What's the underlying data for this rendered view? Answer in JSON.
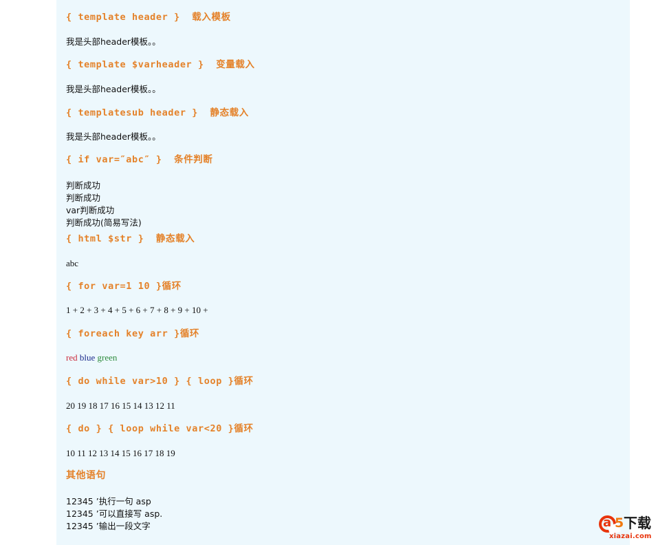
{
  "page": {
    "background_color": "#ffffff",
    "panel_color": "#edf8fd",
    "accent_color": "#e4822a",
    "text_color": "#111111"
  },
  "sections": [
    {
      "id": "template-header",
      "heading": "{ template header }  载入模板",
      "body": "我是头部header模板。。"
    },
    {
      "id": "template-varheader",
      "heading": "{ template $varheader }  变量载入",
      "body": "我是头部header模板。。"
    },
    {
      "id": "templatesub-header",
      "heading": "{ templatesub header }  静态载入",
      "body": "我是头部header模板。。"
    },
    {
      "id": "if-condition",
      "heading": "{ if var=″abc″ }  条件判断",
      "lines": [
        "判断成功",
        "判断成功",
        "var判断成功",
        "判断成功(简易写法)"
      ]
    },
    {
      "id": "html-str",
      "heading": "{ html $str }  静态载入",
      "body": "abc"
    },
    {
      "id": "for-loop",
      "heading": "{ for var=1 10 }循环",
      "body": "1 + 2 + 3 + 4 + 5 + 6 + 7 + 8 + 9 + 10 + "
    },
    {
      "id": "foreach-loop",
      "heading": "{ foreach key arr }循环",
      "color_words": [
        {
          "text": "red",
          "color": "#cc2b3d"
        },
        {
          "text": "blue",
          "color": "#1b2a8c"
        },
        {
          "text": "green",
          "color": "#2e8b3d"
        }
      ]
    },
    {
      "id": "do-while-loop",
      "heading": "{ do while var>10 } { loop }循环",
      "body": "20 19 18 17 16 15 14 13 12 11"
    },
    {
      "id": "do-loop-while",
      "heading": "{ do } { loop while var<20 }循环",
      "body": "10 11 12 13 14 15 16 17 18 19"
    },
    {
      "id": "other-statements",
      "heading": "其他语句",
      "lines": [
        "12345 ’执行一句 asp",
        "12345 ’可以直接写 asp.",
        "12345 ’输出一段文字"
      ]
    }
  ],
  "logo": {
    "mark": "a",
    "digit": "5",
    "cjk": "下载",
    "url": "xiazai.com"
  }
}
